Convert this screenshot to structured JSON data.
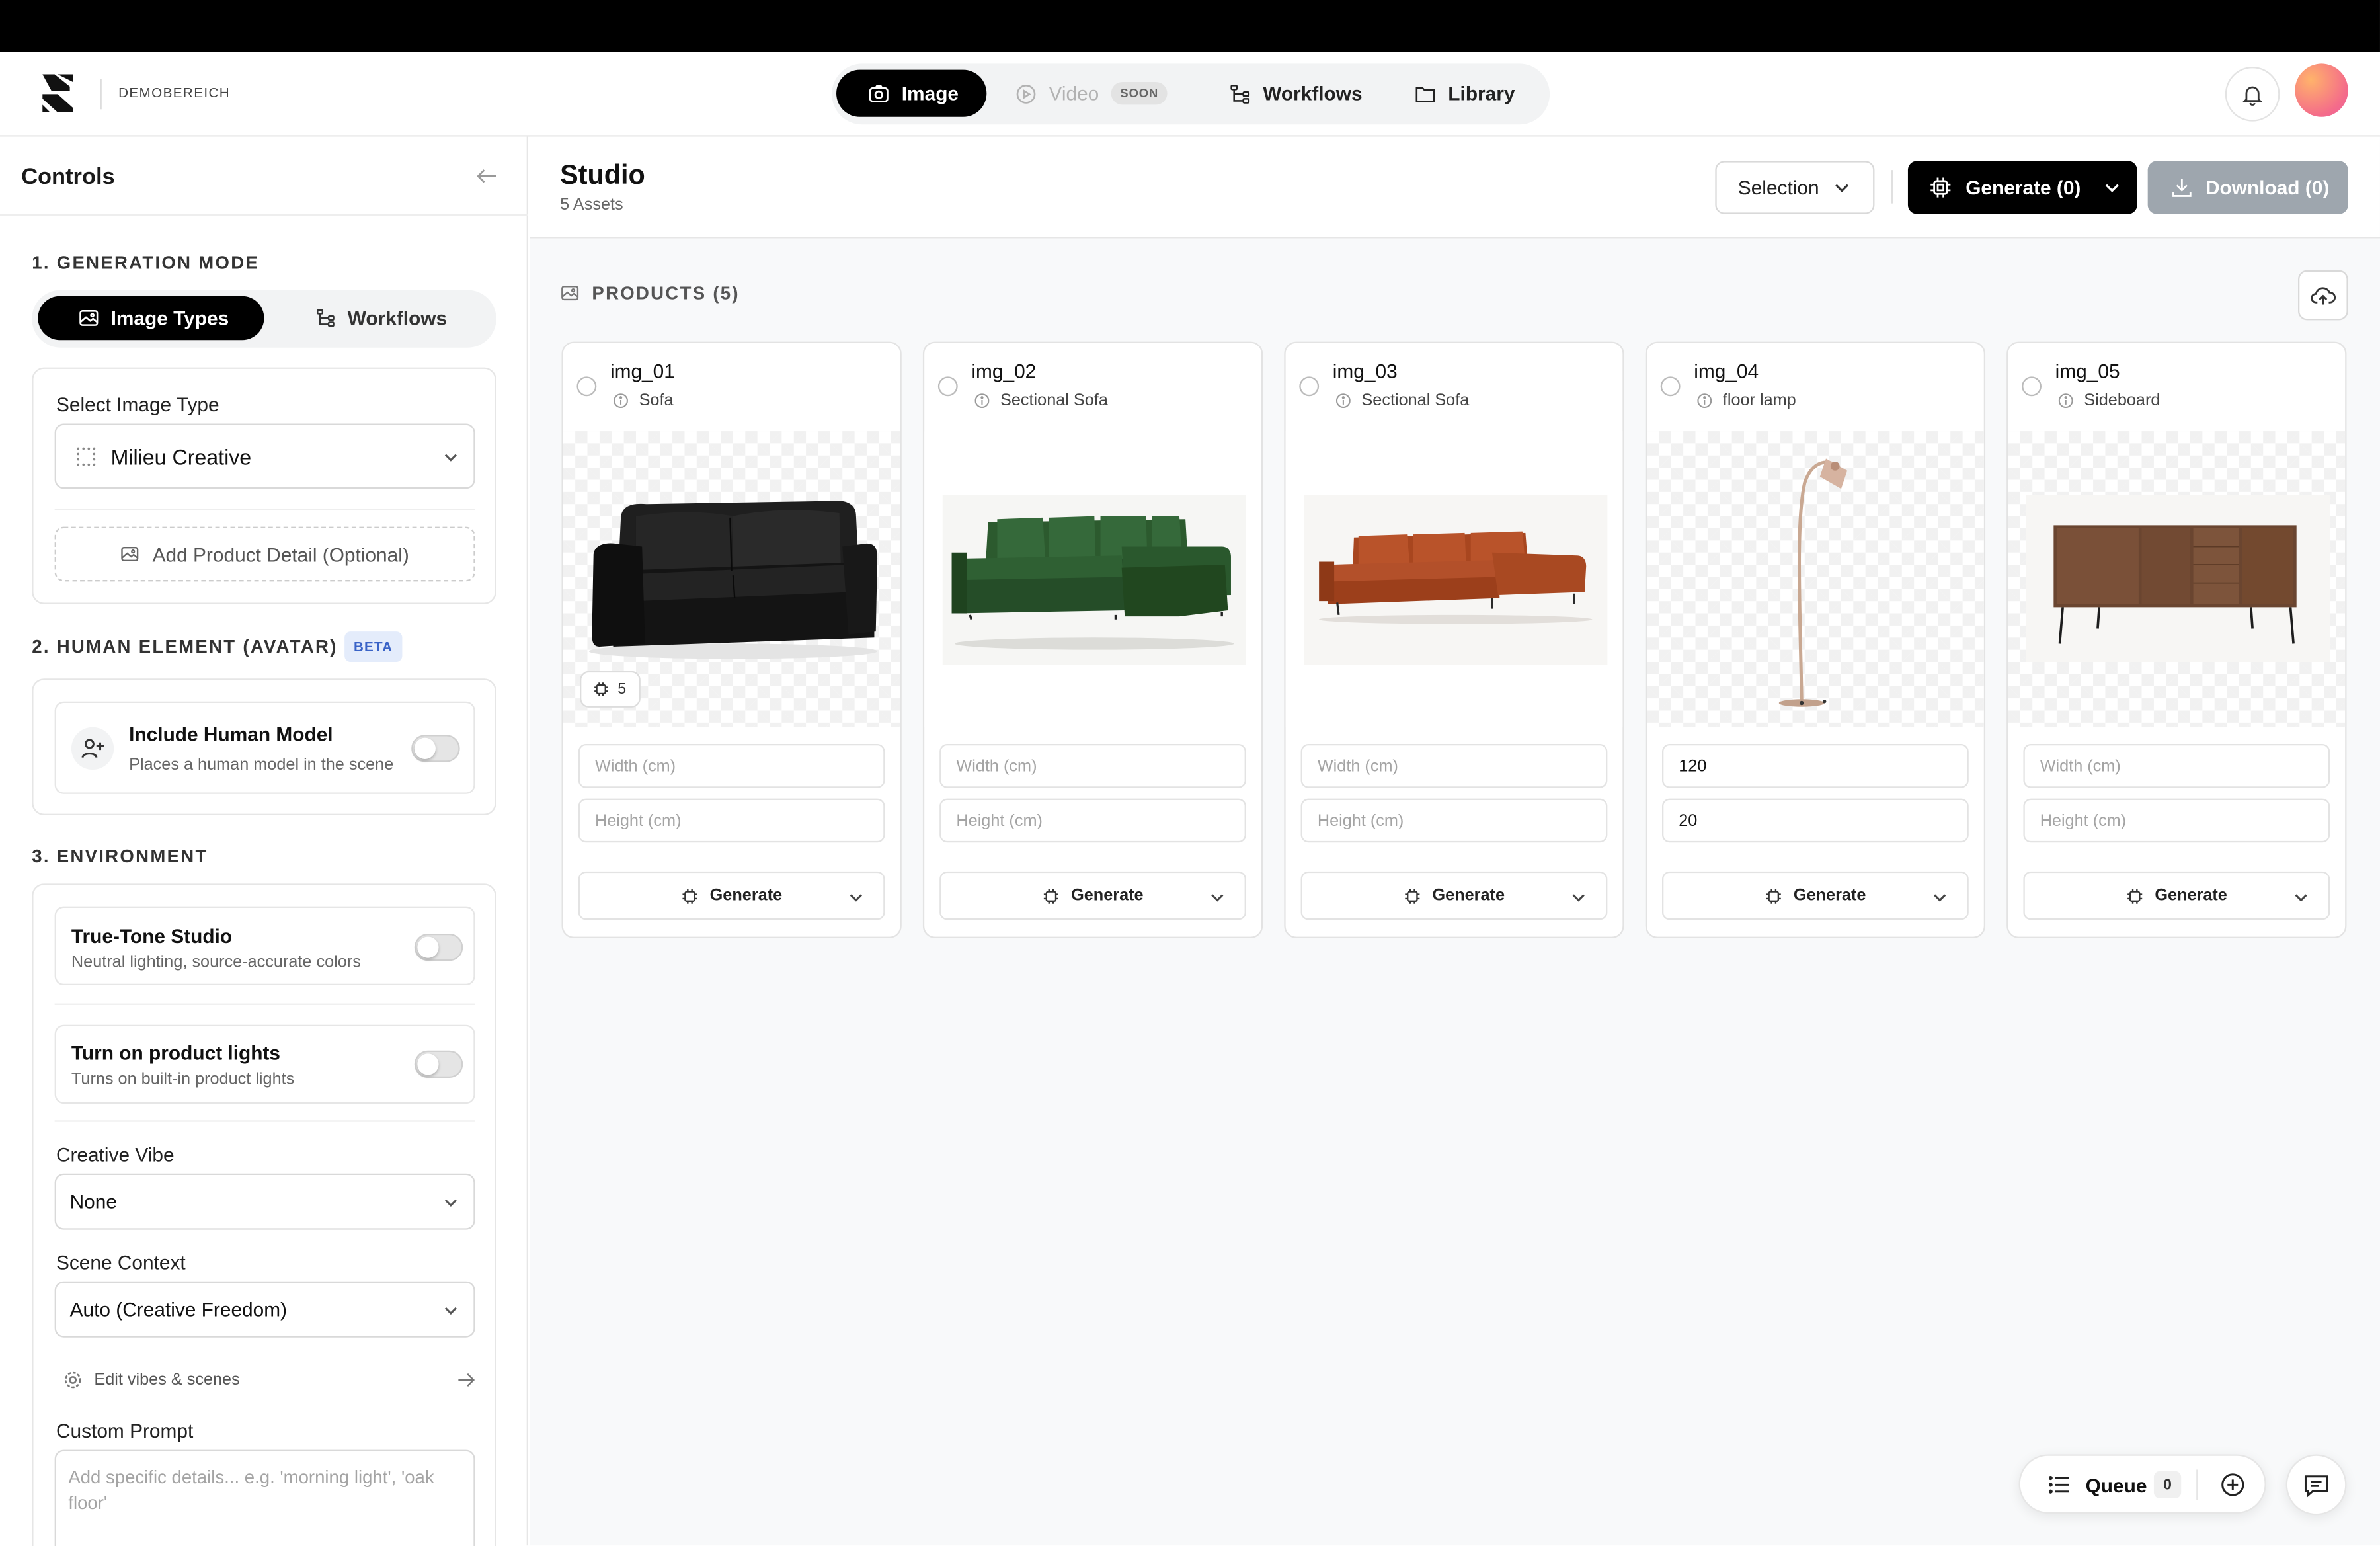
{
  "app": {
    "org_name": "DEMOBEREICH"
  },
  "nav": {
    "image": "Image",
    "video": "Video",
    "video_badge": "SOON",
    "workflows": "Workflows",
    "library": "Library"
  },
  "sidebar": {
    "title": "Controls",
    "section1_title": "1. GENERATION MODE",
    "mode_image_types": "Image Types",
    "mode_workflows": "Workflows",
    "select_image_type_label": "Select Image Type",
    "select_image_type_value": "Milieu Creative",
    "add_product_detail": "Add Product Detail (Optional)",
    "section2_title": "2. HUMAN ELEMENT (AVATAR)",
    "section2_badge": "BETA",
    "human_model_title": "Include Human Model",
    "human_model_sub": "Places a human model in the scene",
    "section3_title": "3. ENVIRONMENT",
    "truetone_title": "True-Tone Studio",
    "truetone_sub": "Neutral lighting, source-accurate colors",
    "product_lights_title": "Turn on product lights",
    "product_lights_sub": "Turns on built-in product lights",
    "creative_vibe_label": "Creative Vibe",
    "creative_vibe_value": "None",
    "scene_context_label": "Scene Context",
    "scene_context_value": "Auto (Creative Freedom)",
    "edit_vibes": "Edit vibes & scenes",
    "custom_prompt_label": "Custom Prompt",
    "custom_prompt_placeholder": "Add specific details... e.g. 'morning light', 'oak floor'"
  },
  "main": {
    "title": "Studio",
    "assets": "5 Assets",
    "selection_button": "Selection",
    "generate_button": "Generate (0)",
    "download_button": "Download (0)",
    "products_header": "PRODUCTS (5)"
  },
  "products": [
    {
      "name": "img_01",
      "type": "Sofa",
      "width": "",
      "height": "",
      "count": "5",
      "illustration": "black-sofa"
    },
    {
      "name": "img_02",
      "type": "Sectional Sofa",
      "width": "",
      "height": "",
      "illustration": "green-sectional"
    },
    {
      "name": "img_03",
      "type": "Sectional Sofa",
      "width": "",
      "height": "",
      "illustration": "orange-sectional"
    },
    {
      "name": "img_04",
      "type": "floor lamp",
      "width": "120",
      "height": "20",
      "illustration": "floor-lamp"
    },
    {
      "name": "img_05",
      "type": "Sideboard",
      "width": "",
      "height": "",
      "illustration": "walnut-sideboard"
    }
  ],
  "card_labels": {
    "width_placeholder": "Width (cm)",
    "height_placeholder": "Height (cm)",
    "generate": "Generate"
  },
  "queue": {
    "label": "Queue",
    "count": "0"
  },
  "colors": {
    "primary": "#000000",
    "download_disabled": "#9ea6ae",
    "beta_badge_bg": "#e4ecfb",
    "beta_badge_text": "#3a63c7"
  },
  "icons": {
    "image": "camera-icon",
    "video": "play-circle-icon",
    "workflows": "workflow-icon",
    "library": "folder-icon",
    "notifications": "bell-icon",
    "upload": "cloud-upload-icon",
    "chat": "chat-icon"
  }
}
